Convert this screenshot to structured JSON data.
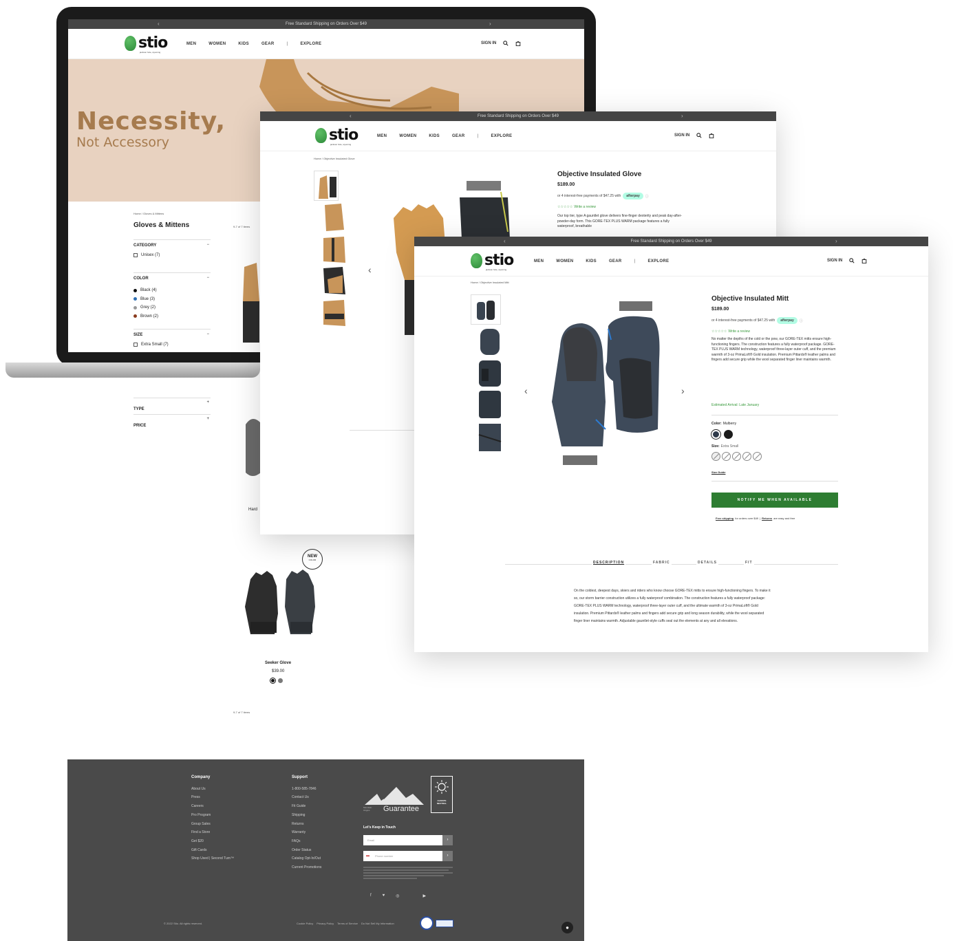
{
  "promo_text": "Free Standard Shipping on Orders Over $49",
  "logo": {
    "word": "stio",
    "tagline": "jackson hole, wyoming"
  },
  "nav": {
    "items": [
      "MEN",
      "WOMEN",
      "KIDS",
      "GEAR",
      "|",
      "EXPLORE"
    ],
    "sign_in": "SIGN IN"
  },
  "laptop": {
    "hero_title": "Necessity,",
    "hero_subtitle": "Not Accessory",
    "breadcrumb": "Home / Gloves & Mittens",
    "page_title": "Gloves & Mittens",
    "count_top": "9-7 of 7 items",
    "filters": {
      "category": {
        "title": "CATEGORY",
        "items": [
          "Unisex (7)"
        ]
      },
      "color": {
        "title": "COLOR",
        "items": [
          {
            "label": "Black (4)",
            "color": "#111111"
          },
          {
            "label": "Blue (3)",
            "color": "#2f6fb3"
          },
          {
            "label": "Grey (2)",
            "color": "#9a9a9a"
          },
          {
            "label": "Brown (2)",
            "color": "#8a3b1e"
          }
        ]
      },
      "size": {
        "title": "SIZE",
        "items": [
          "Extra Small (7)"
        ]
      },
      "type": {
        "title": "TYPE"
      },
      "price": {
        "title": "PRICE"
      }
    }
  },
  "listing": {
    "partial_product": "Hard",
    "new_badge": "NEW",
    "new_badge_sub": "COLOR",
    "product_name": "Seeker Glove",
    "product_price": "$39.00",
    "count_bottom": "9-7 of 7 items"
  },
  "footer": {
    "company": {
      "heading": "Company",
      "links": [
        "About Us",
        "Press",
        "Careers",
        "Pro Program",
        "Group Sales",
        "Find a Store",
        "Get $20",
        "Gift Cards",
        "Shop Used | Second Turn™"
      ]
    },
    "support": {
      "heading": "Support",
      "links": [
        "1-800-585-7846",
        "Contact Us",
        "Fit Guide",
        "Shipping",
        "Returns",
        "Warranty",
        "FAQs",
        "Order Status",
        "Catalog Opt-In/Out",
        "Current Promotions"
      ]
    },
    "guarantee": "Guarantee",
    "guarantee_sub": "Mountain Origins",
    "climate_badge": "CLIMATE NEUTRAL",
    "keep_in_touch": "Let's Keep in Touch",
    "email_placeholder": "Email",
    "phone_placeholder": "Phone number",
    "copyright": "© 2022 Stio. All rights reserved.",
    "legal_links": [
      "Cookie Policy",
      "Privacy Policy",
      "Terms of Service",
      "Do Not Sell My Information"
    ]
  },
  "glove_page": {
    "breadcrumb": "Home / Objective Insulated Glove",
    "title": "Objective Insulated Glove",
    "price": "$189.00",
    "afterpay_text": "or 4 interest-free payments of $47.25 with",
    "afterpay_badge": "afterpay",
    "review_link": "Write a review",
    "description": "Our top tier, type A gauntlet glove delivers fine-finger dexterity and peak day-after-powder-day form. This GORE-TEX PLUS WARM package features a fully waterproof, breathable"
  },
  "mitt_page": {
    "breadcrumb": "Home / Objective Insulated Mitt",
    "title": "Objective Insulated Mitt",
    "price": "$189.00",
    "afterpay_text": "or 4 interest-free payments of $47.25 with",
    "afterpay_badge": "afterpay",
    "review_link": "Write a review",
    "description": "No matter the depths of the cold or the pow, our GORE-TEX mitts ensure high-functioning fingers. The construction features a fully waterproof package. GORE-TEX PLUS WARM technology, waterproof three-layer outer cuff, and the premium warmth of 3-oz PrimaLoft® Gold insulation. Premium Pittards® leather palms and fingers add secure grip while the wool separated finger liner maintains warmth.",
    "arrival": "Estimated Arrival: Late January",
    "color_label": "Color:",
    "color_value": "Mulberry",
    "size_label": "Size:",
    "size_value": "Extra Small",
    "size_guide": "Size Guide",
    "notify_button": "NOTIFY ME WHEN AVAILABLE",
    "shipping_note_a": "Free shipping",
    "shipping_note_b": "for orders over $49",
    "shipping_note_c": "Returns",
    "shipping_note_d": "are easy and free",
    "tabs": [
      "DESCRIPTION",
      "FABRIC",
      "DETAILS",
      "FIT"
    ],
    "long_description": "On the coldest, deepest days, skiers and riders who know choose GORE-TEX mitts to ensure high-functioning fingers. To make it so, our storm barrier construction utilizes a fully waterproof combination. The construction features a fully waterproof package: GORE-TEX PLUS WARM technology, waterproof three-layer outer cuff, and the ultimate warmth of 3-oz PrimaLoft® Gold insulation. Premium Pittards® leather palms and fingers add secure grip and long season durability, while the wool separated finger liner maintains warmth. Adjustable gauntlet-style cuffs seal out the elements at any and all elevations."
  },
  "colors": {
    "brand_green": "#2e7d32",
    "dark_bar": "#454545",
    "footer": "#4a4a4a",
    "hero_bg": "#e8d2c0",
    "hero_text": "#a67b4e"
  }
}
